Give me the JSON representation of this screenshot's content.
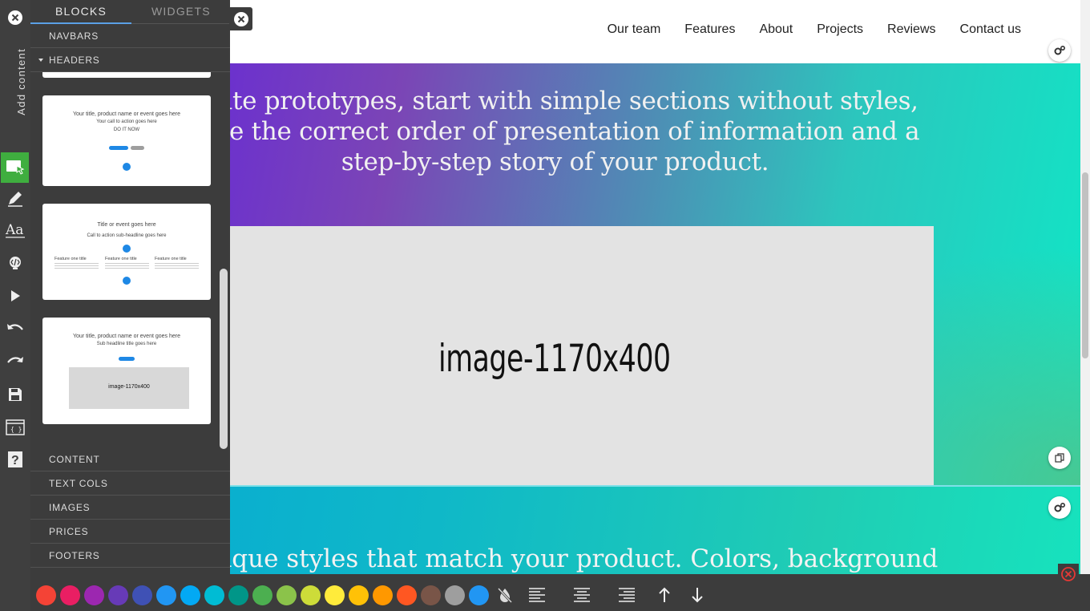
{
  "nav": {
    "links": [
      "Our team",
      "Features",
      "About",
      "Projects",
      "Reviews",
      "Contact us"
    ]
  },
  "hero1": {
    "text_lines": [
      "reate prototypes, start with simple sections without styles,",
      "eate the correct order of presentation of information and a",
      "step-by-step story of your product."
    ],
    "image_label": "image-1170x400"
  },
  "hero2": {
    "text": "l unique styles that match your product. Colors, background"
  },
  "sidebar": {
    "add_content_label": "Add content",
    "tools": [
      "add-content",
      "edit",
      "typography",
      "code",
      "preview",
      "undo",
      "redo",
      "save",
      "export",
      "help"
    ]
  },
  "panel": {
    "tabs": [
      "BLOCKS",
      "WIDGETS"
    ],
    "active_tab": "BLOCKS",
    "categories_top": [
      "NAVBARS",
      "HEADERS"
    ],
    "categories_bottom": [
      "CONTENT",
      "TEXT COLS",
      "IMAGES",
      "PRICES",
      "FOOTERS"
    ],
    "thumb1": {
      "title": "Your title, product name or event goes here",
      "subtitle": "Your call to action goes here",
      "cta": "DO IT NOW"
    },
    "thumb2": {
      "title": "Title or event goes here",
      "subtitle": "Call to action sub-headline goes here",
      "col_title": "Feature one title"
    },
    "thumb3": {
      "title": "Your title, product name or event goes here",
      "subtitle": "Sub headline title goes here",
      "image_label": "image-1170x400"
    }
  },
  "colorbar": {
    "colors": [
      "#f44336",
      "#e91e63",
      "#9c27b0",
      "#673ab7",
      "#3f51b5",
      "#2196f3",
      "#03a9f4",
      "#00bcd4",
      "#009688",
      "#4caf50",
      "#8bc34a",
      "#cddc39",
      "#ffeb3b",
      "#ffc107",
      "#ff9800",
      "#ff5722",
      "#795548",
      "#9e9e9e",
      "#2196f3"
    ],
    "tools": [
      "no-color-icon",
      "align-left-icon",
      "align-center-icon",
      "align-right-icon",
      "move-up-icon",
      "move-down-icon"
    ]
  }
}
